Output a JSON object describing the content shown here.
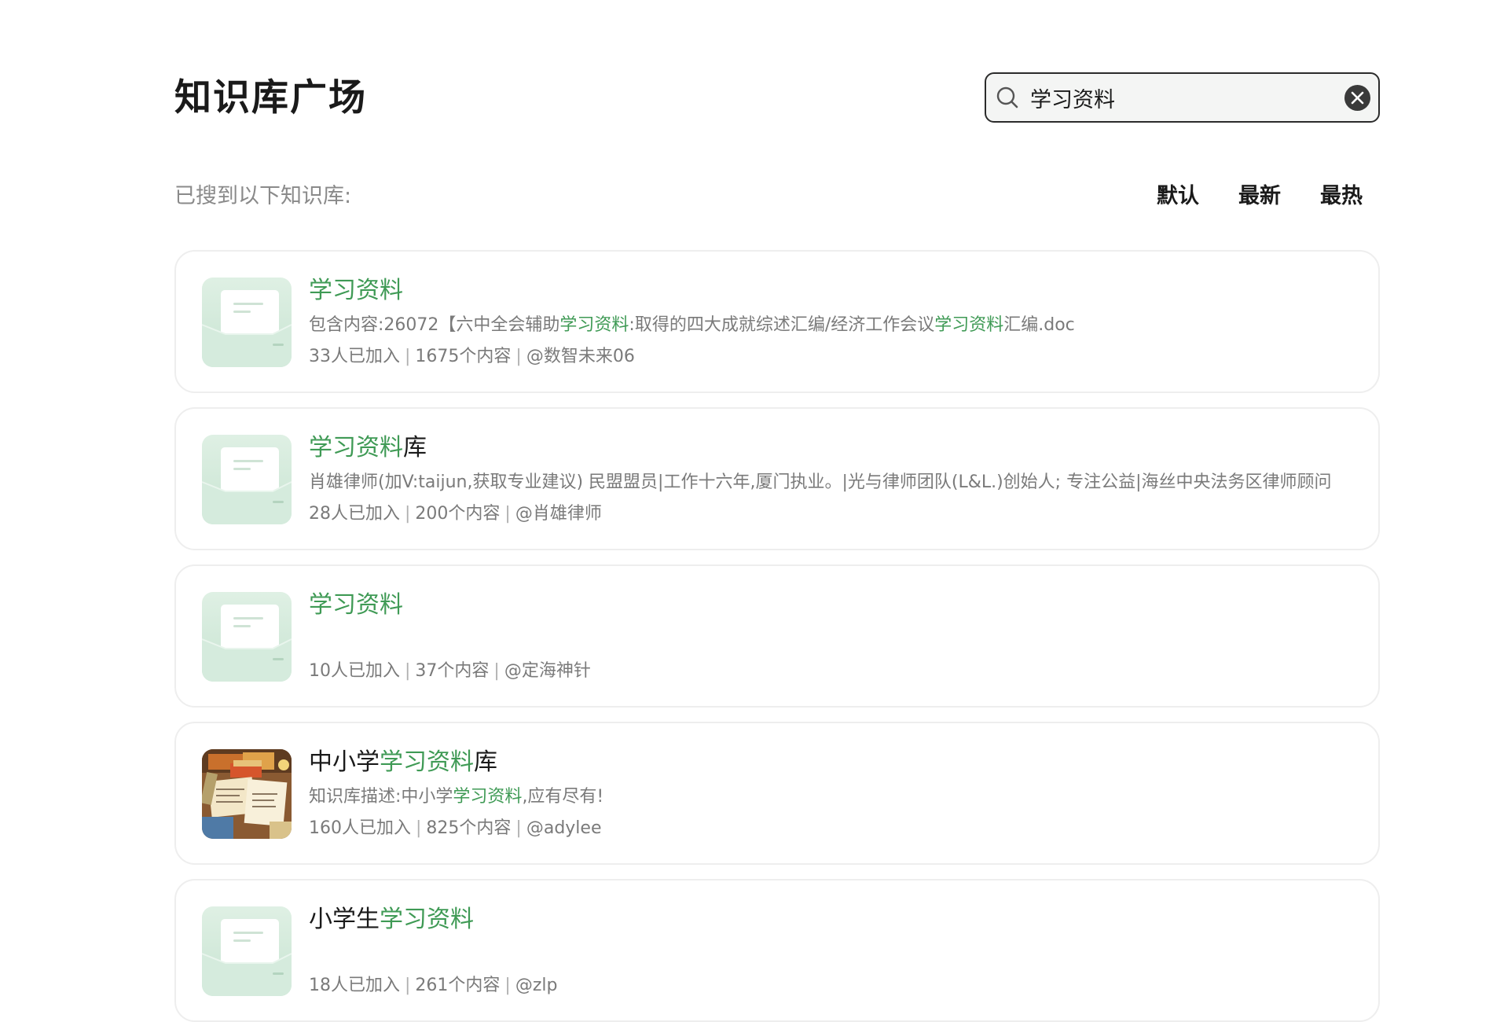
{
  "header": {
    "title": "知识库广场",
    "search": {
      "value": "学习资料",
      "placeholder": ""
    }
  },
  "results": {
    "label": "已搜到以下知识库:",
    "sort_tabs": [
      {
        "label": "默认"
      },
      {
        "label": "最新"
      },
      {
        "label": "最热"
      }
    ]
  },
  "cards": [
    {
      "thumb": "folder-icon",
      "title_parts": [
        {
          "text": "学习资料",
          "hl": true
        }
      ],
      "desc_parts": [
        {
          "text": "包含内容:26072【六中全会辅助",
          "hl": false
        },
        {
          "text": "学习资料",
          "hl": true
        },
        {
          "text": ":取得的四大成就综述汇编/经济工作会议",
          "hl": false
        },
        {
          "text": "学习资料",
          "hl": true
        },
        {
          "text": "汇编.doc",
          "hl": false
        }
      ],
      "members": "33人已加入",
      "contents": "1675个内容",
      "owner": "@数智未来06"
    },
    {
      "thumb": "folder-icon",
      "title_parts": [
        {
          "text": "学习资料",
          "hl": true
        },
        {
          "text": "库",
          "hl": false
        }
      ],
      "desc_parts": [
        {
          "text": "肖雄律师(加V:taijun,获取专业建议) 民盟盟员|工作十六年,厦门执业。|光与律师团队(L&L.)创始人; 专注公益|海丝中央法务区律师顾问",
          "hl": false
        }
      ],
      "members": "28人已加入",
      "contents": "200个内容",
      "owner": "@肖雄律师"
    },
    {
      "thumb": "folder-icon",
      "title_parts": [
        {
          "text": "学习资料",
          "hl": true
        }
      ],
      "desc_parts": [],
      "members": "10人已加入",
      "contents": "37个内容",
      "owner": "@定海神针"
    },
    {
      "thumb": "study-desk-image",
      "title_parts": [
        {
          "text": "中小学",
          "hl": false
        },
        {
          "text": "学习资料",
          "hl": true
        },
        {
          "text": "库",
          "hl": false
        }
      ],
      "desc_parts": [
        {
          "text": "知识库描述:中小学",
          "hl": false
        },
        {
          "text": "学习资料",
          "hl": true
        },
        {
          "text": ",应有尽有!",
          "hl": false
        }
      ],
      "members": "160人已加入",
      "contents": "825个内容",
      "owner": "@adylee"
    },
    {
      "thumb": "folder-icon",
      "title_parts": [
        {
          "text": "小学生",
          "hl": false
        },
        {
          "text": "学习资料",
          "hl": true
        }
      ],
      "desc_parts": [],
      "members": "18人已加入",
      "contents": "261个内容",
      "owner": "@zlp"
    }
  ],
  "colors": {
    "highlight": "#3f9a55",
    "muted_text": "#7a7a7a",
    "card_border": "#eeeeee",
    "thumb_green": "#cfe8d8"
  }
}
